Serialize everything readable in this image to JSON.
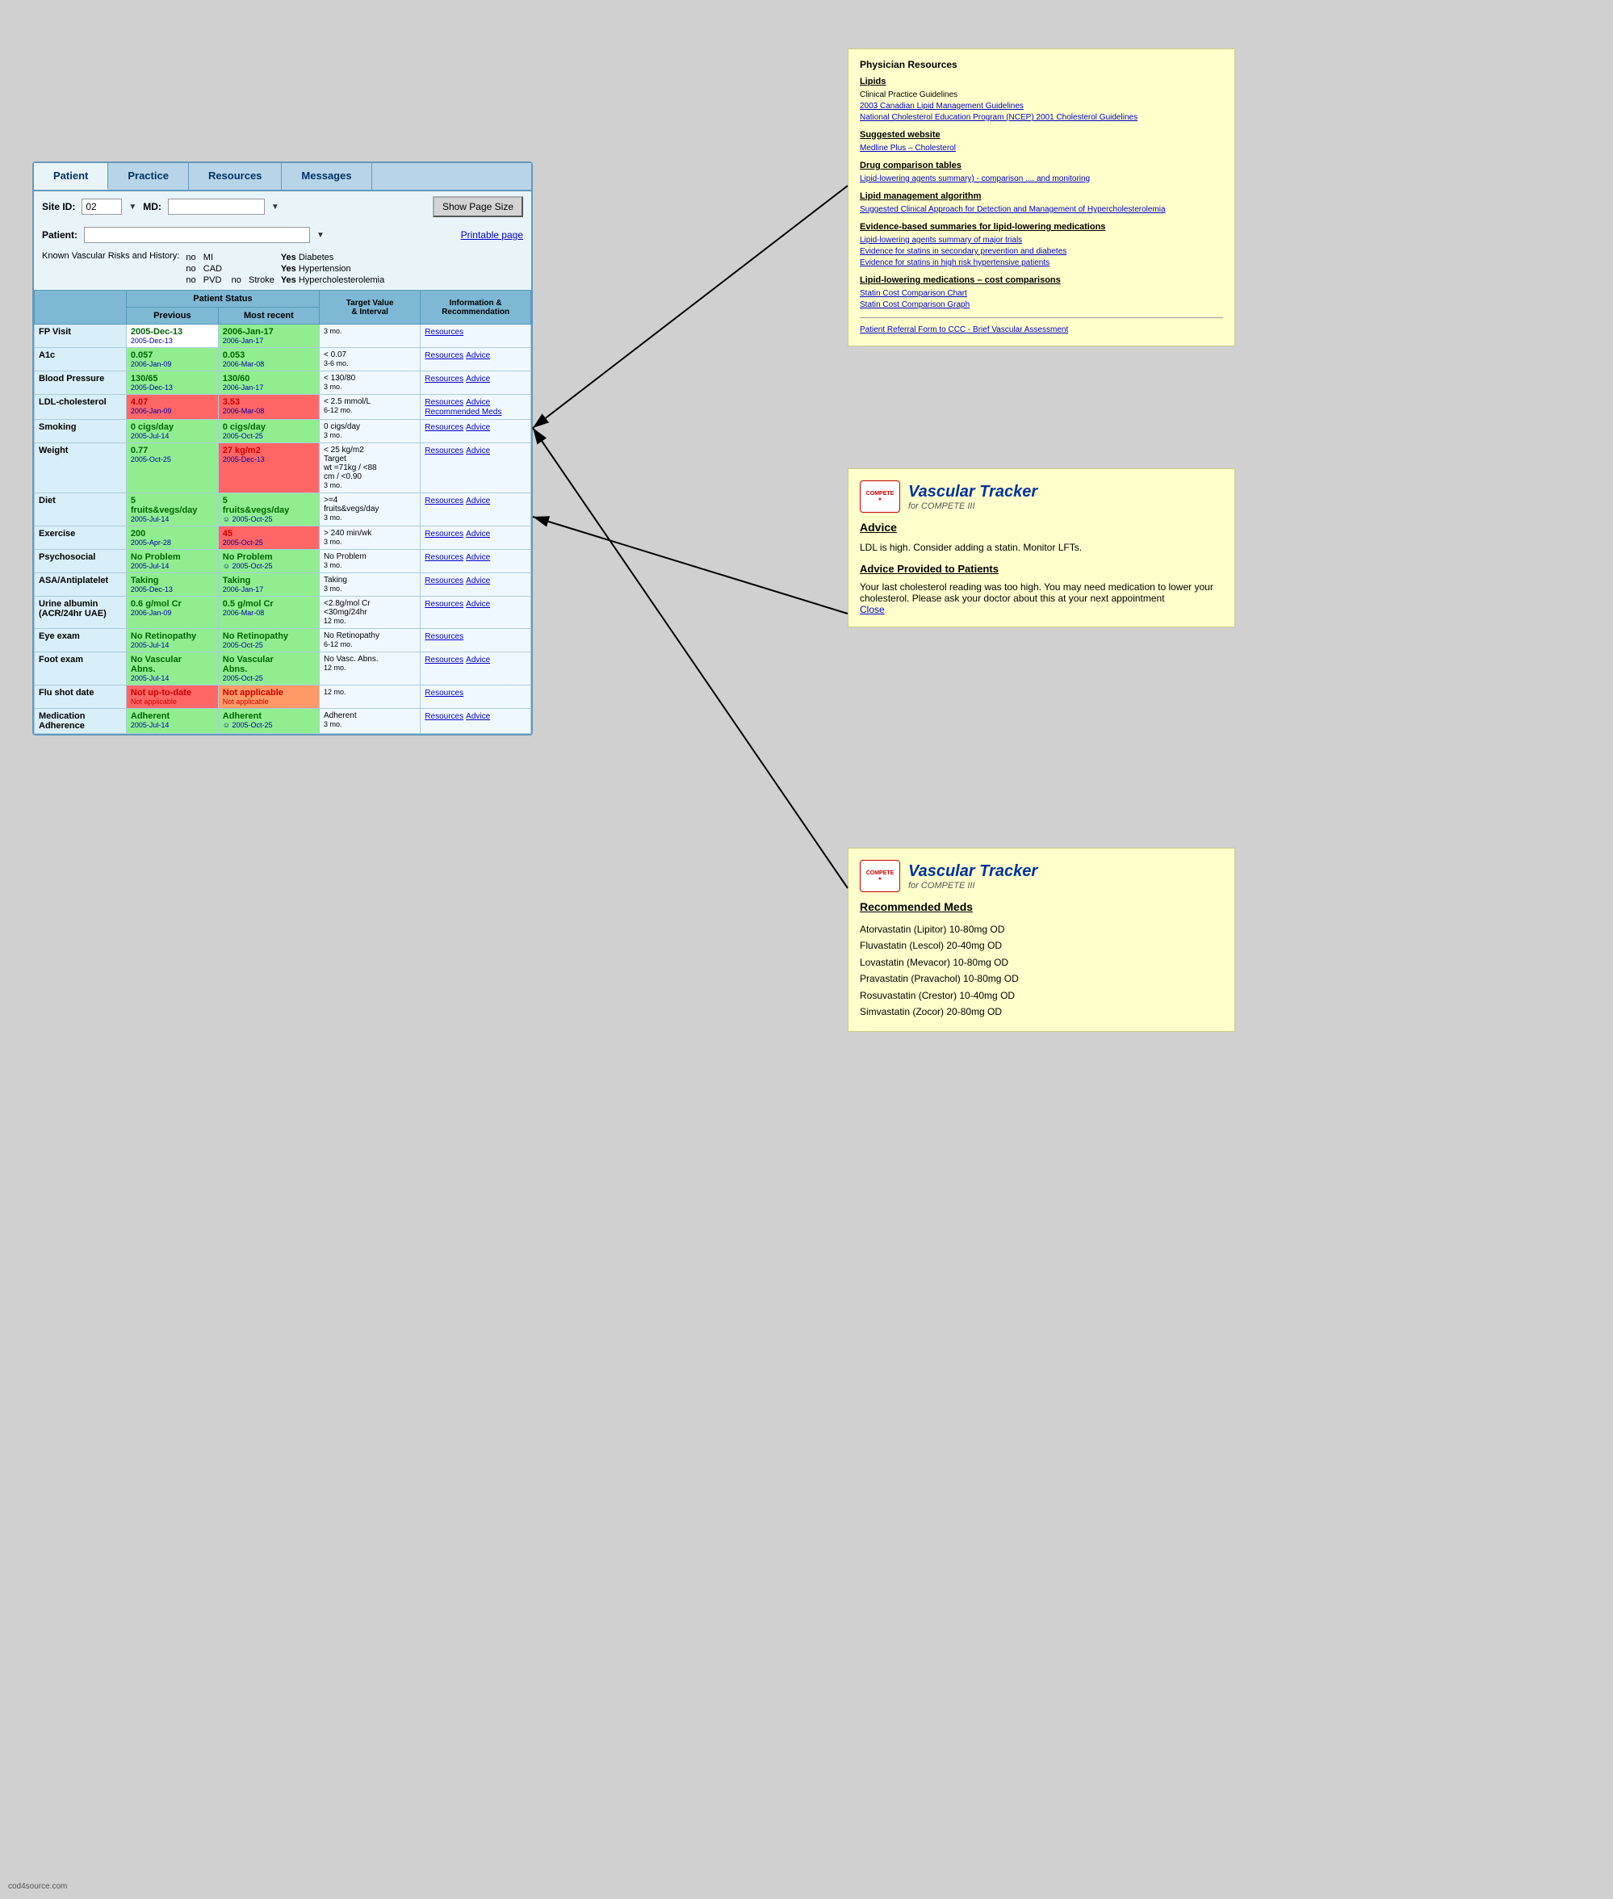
{
  "tabs": [
    {
      "label": "Patient",
      "active": true
    },
    {
      "label": "Practice",
      "active": false
    },
    {
      "label": "Resources",
      "active": false
    },
    {
      "label": "Messages",
      "active": false
    }
  ],
  "form": {
    "site_id_label": "Site ID:",
    "site_id_value": "02",
    "md_label": "MD:",
    "show_page_size_btn": "Show Page Size",
    "patient_label": "Patient:",
    "printable_page": "Printable page"
  },
  "known_risks": {
    "label": "Known Vascular Risks and History:",
    "items": [
      {
        "prefix": "no",
        "condition": "MI",
        "status": "Yes",
        "condition2": "Diabetes"
      },
      {
        "prefix": "no",
        "condition": "CAD",
        "status": "Yes",
        "condition2": "Hypertension"
      },
      {
        "prefix": "no",
        "condition": "PVD",
        "prefix2": "no",
        "condition3": "Stroke",
        "status": "Yes",
        "condition4": "Hypercholesterolemia"
      }
    ]
  },
  "table": {
    "headers": [
      "",
      "Patient Status",
      "",
      "Target Value & Interval",
      "Information & Recommendation"
    ],
    "subheaders": [
      "Previous",
      "Most recent"
    ],
    "rows": [
      {
        "label": "FP Visit",
        "prev": "2005-Dec-13",
        "prev_date": "2005-Dec-13",
        "recent": "2006-Jan-17",
        "recent_date": "2006-Jan-17",
        "target": "",
        "interval": "3 mo.",
        "resources": "Resources",
        "advice": "",
        "rec_meds": "",
        "prev_bg": "",
        "recent_bg": ""
      },
      {
        "label": "A1c",
        "prev": "0.057",
        "prev_date": "2006-Jan-09",
        "recent": "0.053",
        "recent_date": "2006-Mar-08",
        "target": "< 0.07",
        "interval": "3-6 mo.",
        "resources": "Resources",
        "advice": "Advice",
        "rec_meds": "",
        "prev_bg": "green",
        "recent_bg": "green"
      },
      {
        "label": "Blood Pressure",
        "prev": "130/65",
        "prev_date": "2005-Dec-13",
        "recent": "130/60",
        "recent_date": "2006-Jan-17",
        "target": "< 130/80",
        "interval": "3 mo.",
        "resources": "Resources",
        "advice": "Advice",
        "rec_meds": "",
        "prev_bg": "green",
        "recent_bg": "green"
      },
      {
        "label": "LDL-cholesterol",
        "prev": "4.07",
        "prev_date": "2006-Jan-09",
        "recent": "3.53",
        "recent_date": "2006-Mar-08",
        "target": "< 2.5 mmol/L",
        "interval": "6-12 mo.",
        "resources": "Resources",
        "advice": "Advice",
        "rec_meds": "Recommended Meds",
        "prev_bg": "red",
        "recent_bg": "red"
      },
      {
        "label": "Smoking",
        "prev": "0 cigs/day",
        "prev_date": "2005-Jul-14",
        "recent": "0 cigs/day",
        "recent_date": "2005-Oct-25",
        "target": "0 cigs/day",
        "interval": "3 mo.",
        "resources": "Resources",
        "advice": "Advice",
        "rec_meds": "",
        "prev_bg": "green",
        "recent_bg": "green"
      },
      {
        "label": "Weight",
        "prev": "0.77",
        "prev_date": "2005-Oct-25",
        "recent": "27 kg/m2",
        "recent_date": "2005-Dec-13",
        "target": "< 25 kg/m2 Target wt =71kg / <88 cm / <0.90",
        "interval": "3 mo.",
        "resources": "Resources",
        "advice": "Advice",
        "rec_meds": "",
        "prev_bg": "green",
        "recent_bg": "red"
      },
      {
        "label": "Diet",
        "prev": "5 fruits&vegs/day",
        "prev_date": "2005-Jul-14",
        "recent": "5 fruits&vegs/day",
        "recent_date": "☺ 2005-Oct-25",
        "target": ">=4 fruits&vegs/day",
        "interval": "3 mo.",
        "resources": "Resources",
        "advice": "Advice",
        "rec_meds": "",
        "prev_bg": "green",
        "recent_bg": "green"
      },
      {
        "label": "Exercise",
        "prev": "200",
        "prev_date": "2005-Apr-28",
        "recent": "45",
        "recent_date": "2005-Oct-25",
        "target": "> 240 min/wk",
        "interval": "3 mo.",
        "resources": "Resources",
        "advice": "Advice",
        "rec_meds": "",
        "prev_bg": "green",
        "recent_bg": "red"
      },
      {
        "label": "Psychosocial",
        "prev": "No Problem",
        "prev_date": "2005-Jul-14",
        "recent": "No Problem",
        "recent_date": "☺ 2005-Oct-25",
        "target": "No Problem",
        "interval": "3 mo.",
        "resources": "Resources",
        "advice": "Advice",
        "rec_meds": "",
        "prev_bg": "green",
        "recent_bg": "green"
      },
      {
        "label": "ASA/Antiplatelet",
        "prev": "Taking",
        "prev_date": "2005-Dec-13",
        "recent": "Taking",
        "recent_date": "2006-Jan-17",
        "target": "Taking",
        "interval": "3 mo.",
        "resources": "Resources",
        "advice": "Advice",
        "rec_meds": "",
        "prev_bg": "green",
        "recent_bg": "green"
      },
      {
        "label": "Urine albumin (ACR/24hr UAE)",
        "prev": "0.6 g/mol Cr",
        "prev_date": "2006-Jan-09",
        "recent": "0.5 g/mol Cr",
        "recent_date": "2006-Mar-08",
        "target": "<2.8g/mol Cr <30mg/24hr",
        "interval": "12 mo.",
        "resources": "Resources",
        "advice": "Advice",
        "rec_meds": "",
        "prev_bg": "green",
        "recent_bg": "green"
      },
      {
        "label": "Eye exam",
        "prev": "No Retinopathy",
        "prev_date": "2005-Jul-14",
        "recent": "No Retinopathy",
        "recent_date": "2005-Oct-25",
        "target": "No Retinopathy",
        "interval": "6-12 mo.",
        "resources": "Resources",
        "advice": "",
        "rec_meds": "",
        "prev_bg": "green",
        "recent_bg": "green"
      },
      {
        "label": "Foot exam",
        "prev": "No Vascular Abns.",
        "prev_date": "2005-Jul-14",
        "recent": "No Vascular Abns.",
        "recent_date": "2005-Oct-25",
        "target": "No Vasc. Abns.",
        "interval": "12 mo.",
        "resources": "Resources",
        "advice": "Advice",
        "rec_meds": "",
        "prev_bg": "green",
        "recent_bg": "green"
      },
      {
        "label": "Flu shot date",
        "prev": "Not up-to-date",
        "prev_date": "Not applicable",
        "recent": "Not applicable",
        "recent_date": "Not applicable",
        "target": "",
        "interval": "12 mo.",
        "resources": "Resources",
        "advice": "",
        "rec_meds": "",
        "prev_bg": "red",
        "recent_bg": "orange"
      },
      {
        "label": "Medication Adherence",
        "prev": "Adherent",
        "prev_date": "2005-Jul-14",
        "recent": "Adherent",
        "recent_date": "☺ 2005-Oct-25",
        "target": "Adherent",
        "interval": "3 mo.",
        "resources": "Resources",
        "advice": "Advice",
        "rec_meds": "",
        "prev_bg": "green",
        "recent_bg": "green"
      }
    ]
  },
  "physician_resources": {
    "title": "Physician Resources",
    "section1_title": "Lipids",
    "section1_items": [
      "Clinical Practice Guidelines",
      "2003 Canadian Lipid Management Guidelines",
      "National Cholesterol Education Program (NCEP) 2001 Cholesterol Guidelines"
    ],
    "section2_title": "Suggested website",
    "section2_items": [
      "Medline Plus – Cholesterol"
    ],
    "section3_title": "Drug comparison tables",
    "section3_items": [
      "Lipid-lowering agents summary) - comparison .... and monitoring"
    ],
    "section4_title": "Lipid management algorithm",
    "section4_items": [
      "Suggested Clinical Approach for Detection and Management of Hypercholesterolemia"
    ],
    "section5_title": "Evidence-based summaries for lipid-lowering medications",
    "section5_items": [
      "Lipid-lowering agents summary of major trials",
      "Evidence for statins in secondary prevention and diabetes",
      "Evidence for statins in high risk hypertensive patients"
    ],
    "section6_title": "Lipid-lowering medications – cost comparisons",
    "section6_items": [
      "Statin Cost Comparison Chart",
      "Statin Cost Comparison Graph"
    ],
    "section7_items": [
      "Patient Referral Form to CCC - Brief Vascular Assessment"
    ]
  },
  "vascular_advice": {
    "logo_text": "COMPETE",
    "title": "Vascular Tracker",
    "subtitle": "for COMPETE III",
    "advice_title": "Advice",
    "advice_text": "LDL is high. Consider adding a statin. Monitor LFTs.",
    "advice_provided_title": "Advice Provided to Patients",
    "advice_provided_text": "Your last cholesterol reading was too high. You may need medication to lower your cholesterol. Please ask your doctor about this at your next appointment",
    "close_label": "Close"
  },
  "rec_meds": {
    "logo_text": "COMPETE",
    "title": "Vascular Tracker",
    "subtitle": "for COMPETE III",
    "title_label": "Recommended Meds",
    "medications": [
      "Atorvastatin (Lipitor) 10-80mg OD",
      "Fluvastatin (Lescol) 20-40mg OD",
      "Lovastatin (Mevacor) 10-80mg OD",
      "Pravastatin (Pravachol) 10-80mg OD",
      "Rosuvastatin (Crestor) 10-40mg OD",
      "Simvastatin (Zocor) 20-80mg OD"
    ]
  },
  "footer": {
    "text": "cod4source.com"
  }
}
